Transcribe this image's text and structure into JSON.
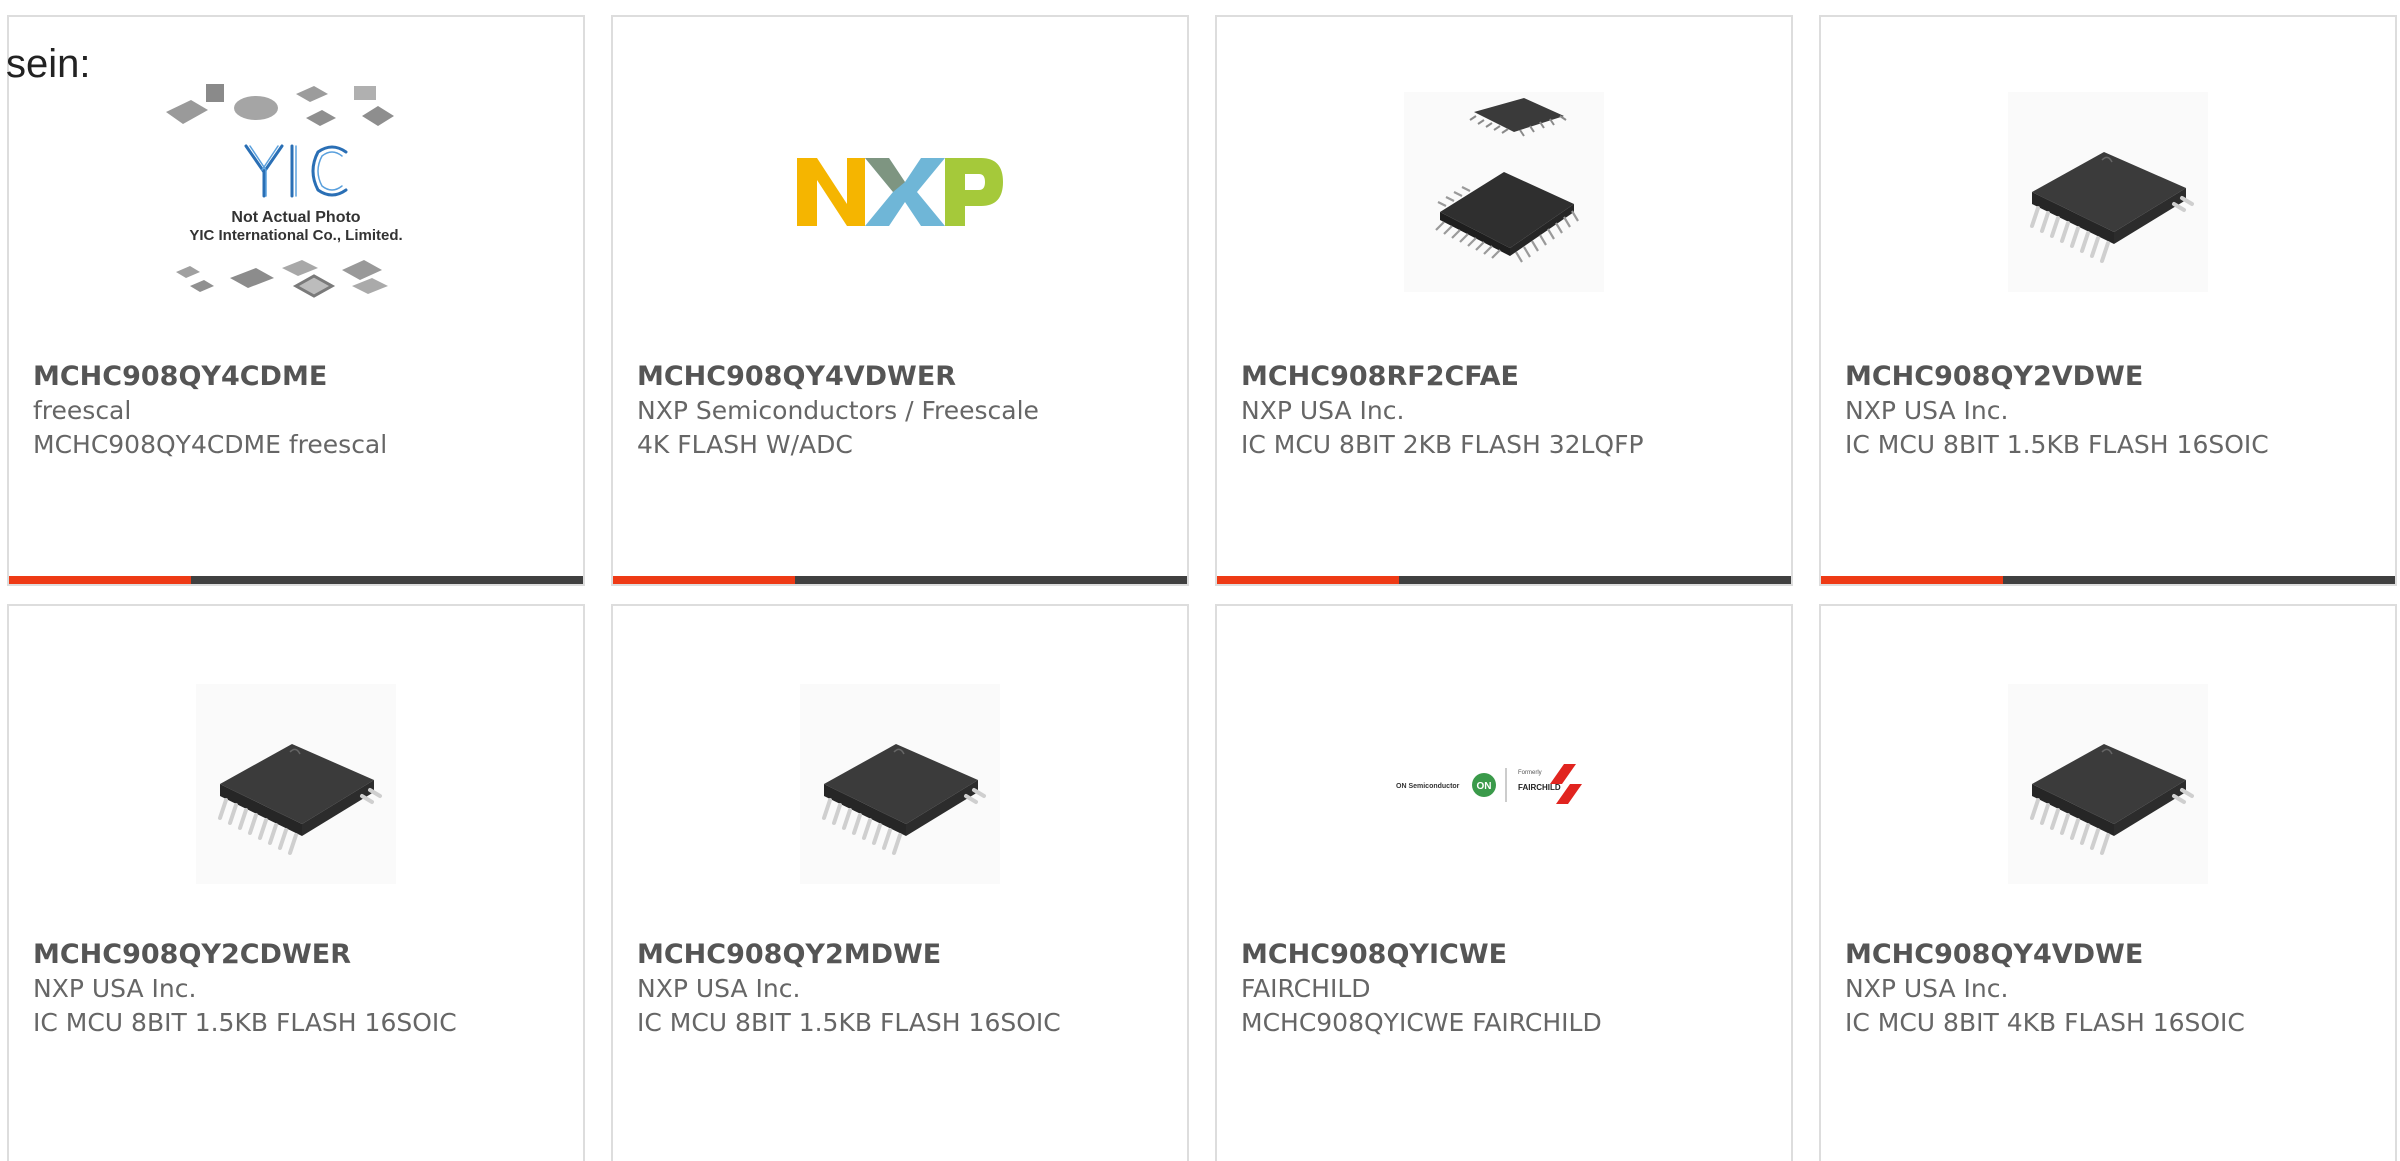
{
  "heading": "sein:",
  "colors": {
    "accent": "#ee3a15",
    "bar_dark": "#404040",
    "card_border": "#dddddd",
    "text": "#666666",
    "nxp_yellow": "#f5b500",
    "nxp_blue": "#6fb6d7",
    "nxp_green": "#a5c93a",
    "fairchild_red": "#e1241f",
    "onsemi_green": "#3a9a4a"
  },
  "placeholder_photo": {
    "brand": "YIC",
    "caption_line1": "Not Actual Photo",
    "caption_line2": "YIC International Co., Limited."
  },
  "onsemi_logo": {
    "left_text": "ON Semiconductor",
    "badge": "ON",
    "formerly": "Formerly",
    "right_text": "FAIRCHILD"
  },
  "products": [
    {
      "part_number": "MCHC908QY4CDME",
      "manufacturer": "freescal",
      "description": "MCHC908QY4CDME freescal",
      "image": "placeholder-photo"
    },
    {
      "part_number": "MCHC908QY4VDWER",
      "manufacturer": "NXP Semiconductors / Freescale",
      "description": "4K FLASH W/ADC",
      "image": "nxp-logo"
    },
    {
      "part_number": "MCHC908RF2CFAE",
      "manufacturer": "NXP USA Inc.",
      "description": "IC MCU 8BIT 2KB FLASH 32LQFP",
      "image": "lqfp-chip"
    },
    {
      "part_number": "MCHC908QY2VDWE",
      "manufacturer": "NXP USA Inc.",
      "description": "IC MCU 8BIT 1.5KB FLASH 16SOIC",
      "image": "soic-chip"
    },
    {
      "part_number": "MCHC908QY2CDWER",
      "manufacturer": "NXP USA Inc.",
      "description": "IC MCU 8BIT 1.5KB FLASH 16SOIC",
      "image": "soic-chip"
    },
    {
      "part_number": "MCHC908QY2MDWE",
      "manufacturer": "NXP USA Inc.",
      "description": "IC MCU 8BIT 1.5KB FLASH 16SOIC",
      "image": "soic-chip"
    },
    {
      "part_number": "MCHC908QYICWE",
      "manufacturer": "FAIRCHILD",
      "description": "MCHC908QYICWE FAIRCHILD",
      "image": "onsemi-fairchild-logo"
    },
    {
      "part_number": "MCHC908QY4VDWE",
      "manufacturer": "NXP USA Inc.",
      "description": "IC MCU 8BIT 4KB FLASH 16SOIC",
      "image": "soic-chip"
    }
  ]
}
